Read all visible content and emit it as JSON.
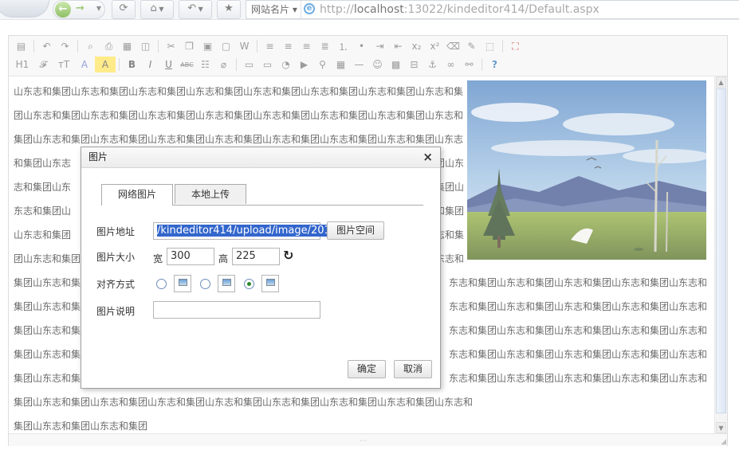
{
  "browser": {
    "site_card_label": "网站名片",
    "url_prefix": "http://",
    "url_host": "localhost",
    "url_rest": ":13022/kindeditor414/Default.aspx"
  },
  "editor": {
    "content_repeat_text": "山东志和集团",
    "content_line_1": "山东志和集团山东志和集团山东志和集团山东志和集团山东志和集团山东志和集团山东志和集团山东志和集",
    "content_line_2": "团山东志和集团山东志和集团山东志和集团山东志和集团山东志和集团山东志和集团山东志和集团山东志和",
    "content_line_3": "集团山东志和集团山东志和集团山东志和集团山东志和集团山东志和集团山东志和集团山东志和集团山东志",
    "content_line_4": "和集团山东志",
    "content_line_4b": "团山东",
    "content_line_5": "志和集团山东",
    "content_line_5b": "东志和集团山",
    "content_line_6": "东志和集团山",
    "content_line_6b": "和集团山东志和集团",
    "content_line_7": "山东志和集团",
    "content_line_7b": "山东志和集",
    "content_line_8": "团山东志和集团",
    "content_line_8b": "团山东志和",
    "content_line_9": "集团山东志和集",
    "content_line_9b": "东志和集团山东志和集团山东志和集团山东志和集团山东志和",
    "content_line_10": "集团山东志和集",
    "content_line_10b": "东志和集团山东志和集团山东志和集团山东志和集团山东志和",
    "content_line_11": "集团山东志和集",
    "content_line_11b": "东志和集团山东志和集团山东志和集团山东志和集团山东志和",
    "content_line_12": "集团山东志和集",
    "content_line_12b": "东志和集团山东志和集团山东志和集团山东志和集团山东志和",
    "content_line_13": "集团山东志和集",
    "content_line_13b": "东志和集团山东志和集团山东志和集团山东志和集团山东志和",
    "content_line_14": "集团山东志和集团山东志和集团山东志和集团山东志和集团山东志和集团山东志和集团山东志和集团山东志和",
    "content_line_15": "集团山东志和集团山东志和集团"
  },
  "toolbar": {
    "row1_icons": [
      "source-icon",
      "undo-icon",
      "redo-icon",
      "preview-icon",
      "print-icon",
      "template-icon",
      "code-icon",
      "cut-icon",
      "copy-icon",
      "paste-icon",
      "plainpaste-icon",
      "wordpaste-icon",
      "justifyleft-icon",
      "justifycenter-icon",
      "justifyright-icon",
      "justifyfull-icon",
      "insertorderedlist-icon",
      "insertunorderedlist-icon",
      "indent-icon",
      "outdent-icon",
      "subscript-icon",
      "superscript-icon",
      "clearhtml-icon",
      "quickformat-icon",
      "selectall-icon",
      "fullscreen-icon"
    ],
    "row2_icons": [
      "formatblock-icon",
      "fontname-icon",
      "fontsize-icon",
      "forecolor-icon",
      "hilitecolor-icon",
      "bold-icon",
      "italic-icon",
      "underline-icon",
      "strikethrough-icon",
      "lineheight-icon",
      "removeformat-icon",
      "image-icon",
      "multiimage-icon",
      "flash-icon",
      "media-icon",
      "insertfile-icon",
      "table-icon",
      "hr-icon",
      "emoticons-icon",
      "baidumap-icon",
      "pagebreak-icon",
      "anchor-icon",
      "link-icon",
      "unlink-icon",
      "about-icon"
    ]
  },
  "dialog": {
    "title": "图片",
    "close_glyph": "×",
    "tab_remote": "网络图片",
    "tab_local": "本地上传",
    "label_url": "图片地址",
    "url_value": "/kindeditor414/upload/image/201211",
    "btn_image_space": "图片空间",
    "label_size": "图片大小",
    "width_label": "宽",
    "width_value": "300",
    "height_label": "高",
    "height_value": "225",
    "label_align": "对齐方式",
    "align_selected": "right",
    "label_title": "图片说明",
    "title_value": "",
    "btn_ok": "确定",
    "btn_cancel": "取消"
  }
}
